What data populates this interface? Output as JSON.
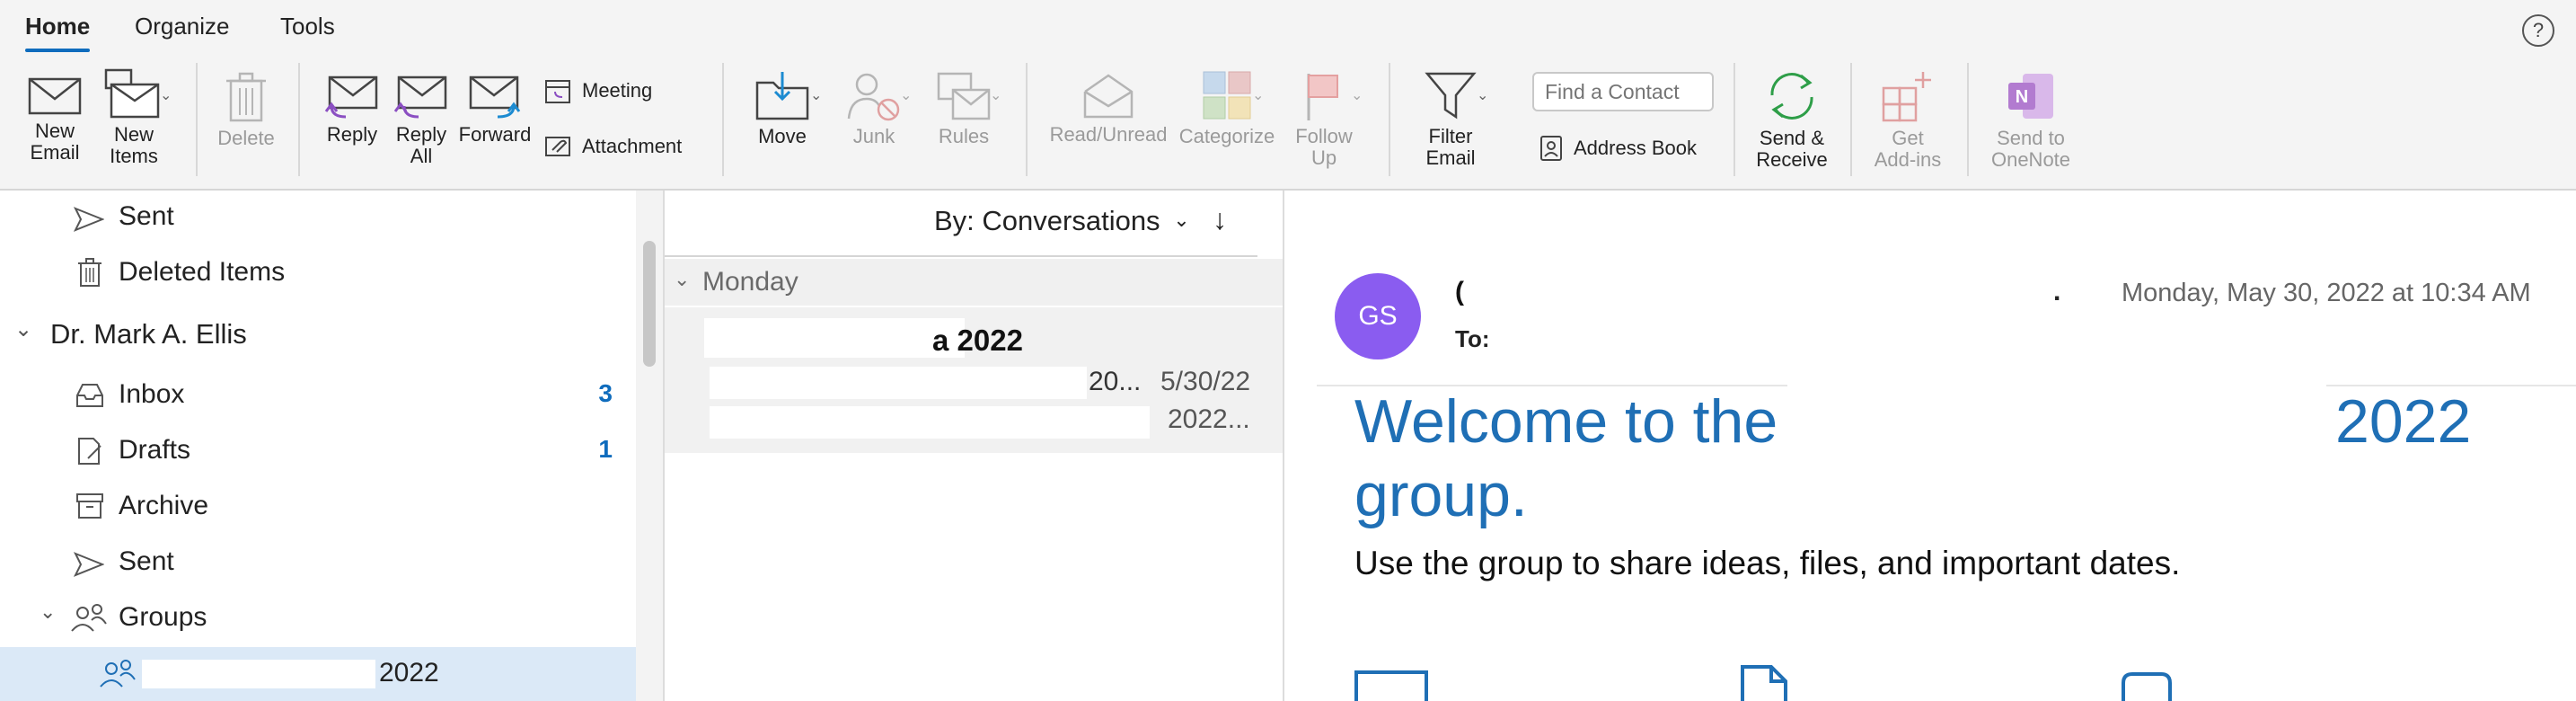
{
  "ribbon": {
    "tabs": [
      "Home",
      "Organize",
      "Tools"
    ],
    "help_label": "?",
    "new_email": [
      "New",
      "Email"
    ],
    "new_items": [
      "New",
      "Items"
    ],
    "delete": "Delete",
    "reply": "Reply",
    "reply_all": [
      "Reply",
      "All"
    ],
    "forward": "Forward",
    "meeting": "Meeting",
    "attachment": "Attachment",
    "move": "Move",
    "junk": "Junk",
    "rules": "Rules",
    "read_unread": "Read/Unread",
    "categorize": "Categorize",
    "follow_up": [
      "Follow",
      "Up"
    ],
    "filter_email": [
      "Filter",
      "Email"
    ],
    "find_contact_placeholder": "Find a Contact",
    "address_book": "Address Book",
    "send_receive": [
      "Send &",
      "Receive"
    ],
    "get_addins": [
      "Get",
      "Add-ins"
    ],
    "send_onenote": [
      "Send to",
      "OneNote"
    ]
  },
  "folders": {
    "sent_top": "Sent",
    "deleted": "Deleted Items",
    "account": "Dr. Mark A. Ellis",
    "inbox": "Inbox",
    "inbox_count": "3",
    "drafts": "Drafts",
    "drafts_count": "1",
    "archive": "Archive",
    "sent": "Sent",
    "groups": "Groups",
    "group_item": "2022"
  },
  "message_list": {
    "sort_label": "By: Conversations",
    "group_header": "Monday",
    "subject": "a 2022",
    "line2": "20...",
    "date": "5/30/22",
    "line3": "2022..."
  },
  "reading": {
    "avatar_initials": "GS",
    "sender_fragment": "(",
    "sender_tail": ".",
    "to_label": "To:",
    "datetime": "Monday, May 30, 2022 at 10:34 AM",
    "welcome_a": "Welcome to the",
    "welcome_b": "2022",
    "welcome_c": "group.",
    "body": "Use the group to share ideas, files, and important dates."
  },
  "colors": {
    "accent": "#0f6cbd",
    "avatar": "#8a5cf0",
    "heading": "#1f6fb5",
    "selected_row": "#dbe9f7"
  }
}
